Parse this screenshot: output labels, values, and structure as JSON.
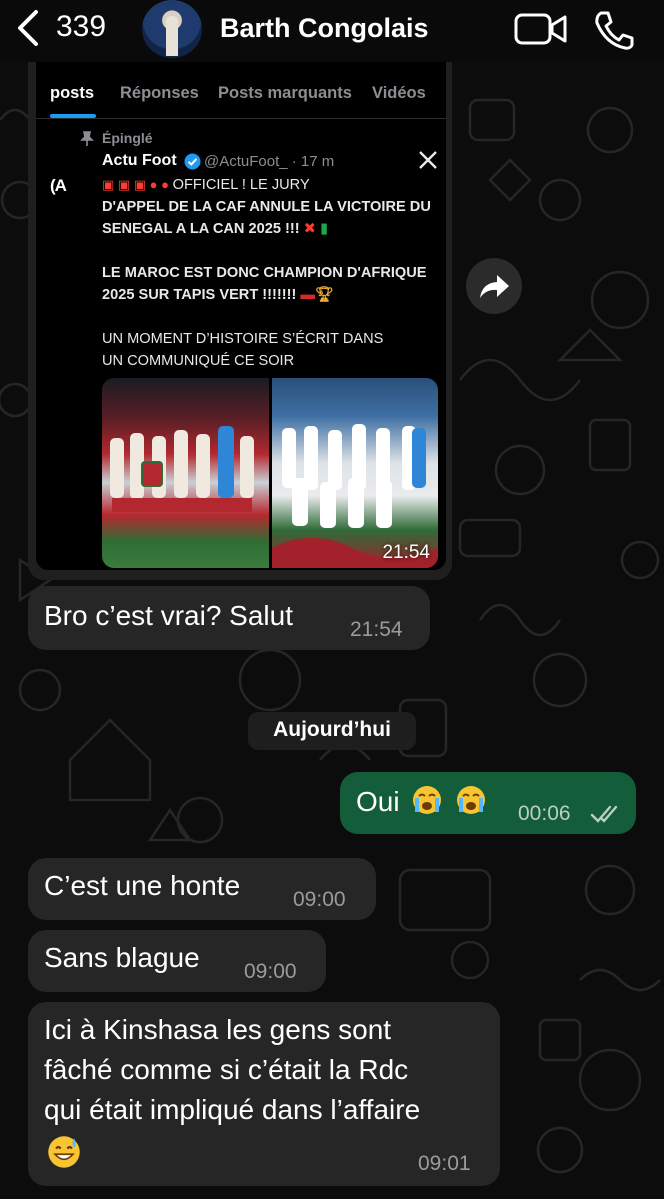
{
  "header": {
    "unread_count": "339",
    "contact_name": "Barth Congolais"
  },
  "shared_post": {
    "tabs": [
      "posts",
      "Réponses",
      "Posts marquants",
      "Vidéos"
    ],
    "pinned_label": "Épinglé",
    "author": "Actu Foot",
    "handle": "@ActuFoot_ · 17 m",
    "avatar_text": "A FOOT",
    "text_lines": [
      "OFFICIEL ! LE JURY",
      "D'APPEL DE LA CAF ANNULE LA VICTOIRE DU",
      "SENEGAL A LA CAN 2025 !!!",
      "LE MAROC EST DONC CHAMPION D'AFRIQUE",
      "2025 SUR TAPIS VERT !!!!!!!",
      "UN MOMENT D’HISTOIRE S’ÉCRIT DANS",
      "UN COMMUNIQUÉ CE SOIR"
    ],
    "time": "21:54"
  },
  "messages": [
    {
      "direction": "in",
      "text": "Bro c’est vrai? Salut",
      "time": "21:54"
    },
    {
      "direction": "out",
      "text": "Oui",
      "emoji": [
        "loudly-crying-face",
        "loudly-crying-face"
      ],
      "time": "00:06",
      "status": "read"
    },
    {
      "direction": "in",
      "text": "C’est une honte",
      "time": "09:00"
    },
    {
      "direction": "in",
      "text": "Sans blague",
      "time": "09:00"
    },
    {
      "direction": "in",
      "lines": [
        "Ici à Kinshasa les gens sont",
        "fâché comme si c’était la Rdc",
        "qui était impliqué dans l’affaire"
      ],
      "emoji": [
        "grinning-face-with-sweat"
      ],
      "time": "09:01"
    }
  ],
  "date_separator": "Aujourd’hui",
  "colors": {
    "incoming_bubble": "#262626",
    "outgoing_bubble": "#145d3a",
    "link_blue": "#1d9bf0"
  }
}
